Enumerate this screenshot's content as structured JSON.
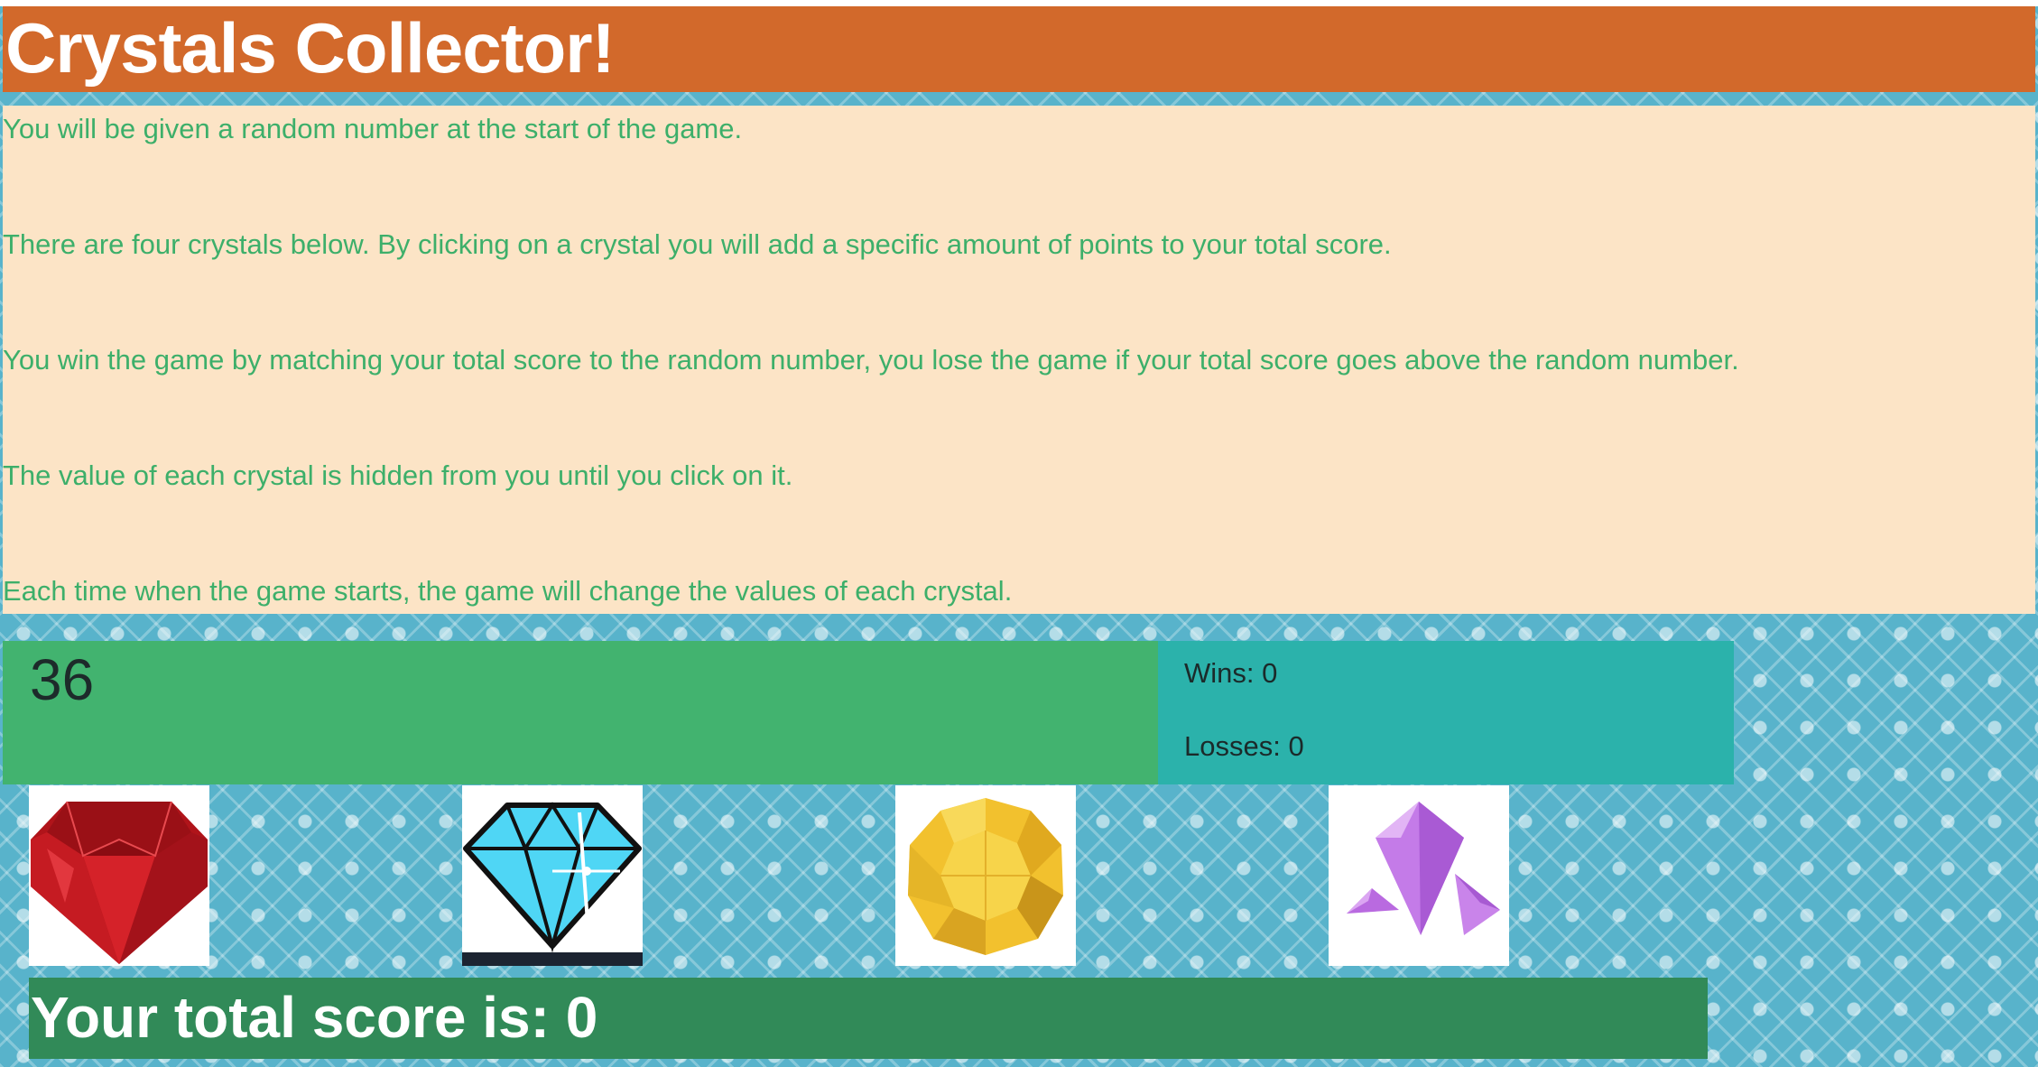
{
  "header": {
    "title": "Crystals Collector!"
  },
  "instructions": [
    "You will be given a random number at the start of the game.",
    "There are four crystals below. By clicking on a crystal you will add a specific amount of points to your total score.",
    "You win the game by matching your total score to the random number, you lose the game if your total score goes above the random number.",
    "The value of each crystal is hidden from you until you click on it.",
    "Each time when the game starts, the game will change the values of each crystal."
  ],
  "game": {
    "target_number": "36",
    "wins_label": "Wins: 0",
    "losses_label": "Losses: 0",
    "score_label": "Your total score is: 0"
  },
  "crystals": [
    {
      "name": "red-ruby",
      "icon": "red-gem-icon",
      "color": "#c0161c"
    },
    {
      "name": "blue-diamond",
      "icon": "blue-diamond-icon",
      "color": "#4fd6f5"
    },
    {
      "name": "yellow-gem",
      "icon": "yellow-gem-icon",
      "color": "#f2c12e"
    },
    {
      "name": "purple-crystal",
      "icon": "purple-crystal-icon",
      "color": "#c47be8"
    }
  ],
  "colors": {
    "header_bg": "#d2692b",
    "instructions_bg": "#fce4c6",
    "instruction_text": "#3daf6a",
    "target_bg": "#42b36f",
    "stats_bg": "#2bb2ab",
    "score_bg": "#318a58",
    "page_pattern": "#58b3cb"
  }
}
